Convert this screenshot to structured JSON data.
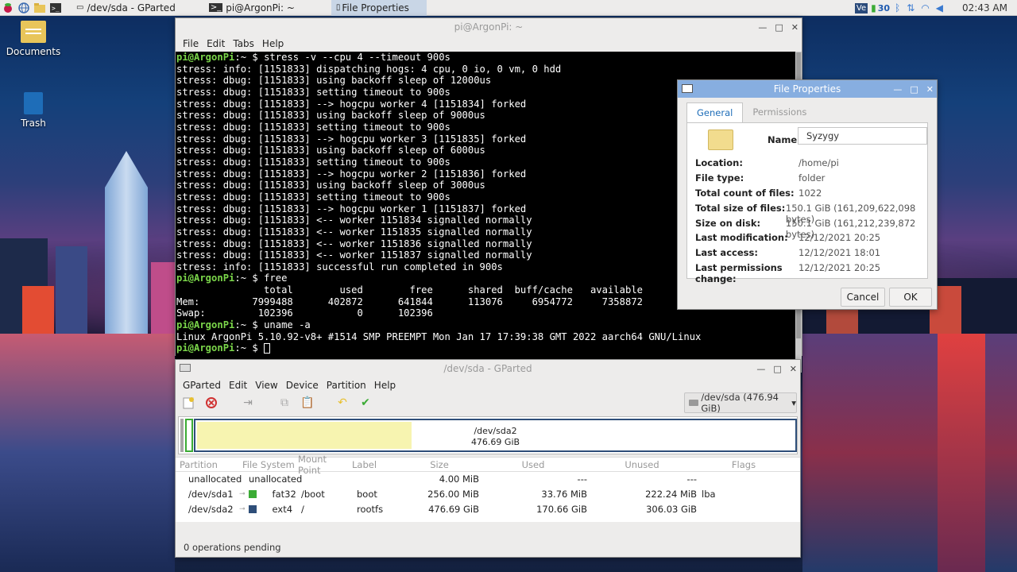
{
  "taskbar": {
    "tasks": [
      {
        "label": "/dev/sda - GParted",
        "icon": "gparted-icon"
      },
      {
        "label": "pi@ArgonPi: ~",
        "icon": "terminal-icon"
      },
      {
        "label": "File Properties",
        "icon": "file-icon"
      }
    ],
    "tray": {
      "cpu_temp": "30",
      "clock": "02:43 AM"
    }
  },
  "desktop": {
    "icons": [
      {
        "label": "Documents",
        "icon": "folder-icon"
      },
      {
        "label": "Trash",
        "icon": "trash-icon"
      }
    ]
  },
  "terminal": {
    "title": "pi@ArgonPi: ~",
    "menu": [
      "File",
      "Edit",
      "Tabs",
      "Help"
    ],
    "prompt": "pi@ArgonPi",
    "prompt_suffix": ":~ $",
    "lines": [
      {
        "prompt": true,
        "text": " stress -v --cpu 4 --timeout 900s"
      },
      {
        "text": "stress: info: [1151833] dispatching hogs: 4 cpu, 0 io, 0 vm, 0 hdd"
      },
      {
        "text": "stress: dbug: [1151833] using backoff sleep of 12000us"
      },
      {
        "text": "stress: dbug: [1151833] setting timeout to 900s"
      },
      {
        "text": "stress: dbug: [1151833] --> hogcpu worker 4 [1151834] forked"
      },
      {
        "text": "stress: dbug: [1151833] using backoff sleep of 9000us"
      },
      {
        "text": "stress: dbug: [1151833] setting timeout to 900s"
      },
      {
        "text": "stress: dbug: [1151833] --> hogcpu worker 3 [1151835] forked"
      },
      {
        "text": "stress: dbug: [1151833] using backoff sleep of 6000us"
      },
      {
        "text": "stress: dbug: [1151833] setting timeout to 900s"
      },
      {
        "text": "stress: dbug: [1151833] --> hogcpu worker 2 [1151836] forked"
      },
      {
        "text": "stress: dbug: [1151833] using backoff sleep of 3000us"
      },
      {
        "text": "stress: dbug: [1151833] setting timeout to 900s"
      },
      {
        "text": "stress: dbug: [1151833] --> hogcpu worker 1 [1151837] forked"
      },
      {
        "text": "stress: dbug: [1151833] <-- worker 1151834 signalled normally"
      },
      {
        "text": "stress: dbug: [1151833] <-- worker 1151835 signalled normally"
      },
      {
        "text": "stress: dbug: [1151833] <-- worker 1151836 signalled normally"
      },
      {
        "text": "stress: dbug: [1151833] <-- worker 1151837 signalled normally"
      },
      {
        "text": "stress: info: [1151833] successful run completed in 900s"
      },
      {
        "prompt": true,
        "text": " free"
      },
      {
        "text": "               total        used        free      shared  buff/cache   available"
      },
      {
        "text": "Mem:         7999488      402872      641844      113076     6954772     7358872"
      },
      {
        "text": "Swap:         102396           0      102396"
      },
      {
        "prompt": true,
        "text": " uname -a"
      },
      {
        "text": "Linux ArgonPi 5.10.92-v8+ #1514 SMP PREEMPT Mon Jan 17 17:39:38 GMT 2022 aarch64 GNU/Linux"
      },
      {
        "prompt": true,
        "text": " ",
        "cursor": true
      }
    ]
  },
  "file_properties": {
    "title": "File Properties",
    "tabs": [
      "General",
      "Permissions"
    ],
    "name_label": "Name:",
    "name_value": "Syzygy",
    "rows": [
      {
        "label": "Location:",
        "value": "/home/pi"
      },
      {
        "label": "File type:",
        "value": "folder"
      },
      {
        "label": "Total count of files:",
        "value": "1022"
      },
      {
        "label": "Total size of files:",
        "value": "150.1 GiB (161,209,622,098 bytes)"
      },
      {
        "label": "Size on disk:",
        "value": "150.1 GiB (161,212,239,872 bytes)"
      },
      {
        "label": "Last modification:",
        "value": "12/12/2021 20:25"
      },
      {
        "label": "Last access:",
        "value": "12/12/2021 18:01"
      },
      {
        "label": "Last permissions change:",
        "value": "12/12/2021 20:25"
      }
    ],
    "cancel_label": "Cancel",
    "ok_label": "OK"
  },
  "gparted": {
    "title": "/dev/sda - GParted",
    "menu": [
      "GParted",
      "Edit",
      "View",
      "Device",
      "Partition",
      "Help"
    ],
    "device_selector": "/dev/sda (476.94 GiB)",
    "diskmap": {
      "name": "/dev/sda2",
      "size": "476.69 GiB",
      "used_fraction": 0.36
    },
    "columns": [
      "Partition",
      "File System",
      "Mount Point",
      "Label",
      "Size",
      "Used",
      "Unused",
      "Flags"
    ],
    "rows": [
      {
        "partition": "unallocated",
        "fs": "unallocated",
        "mount": "",
        "label": "",
        "size": "4.00 MiB",
        "used": "---",
        "unused": "---",
        "flags": "",
        "color": "#a8a8a8",
        "key": false
      },
      {
        "partition": "/dev/sda1",
        "fs": "fat32",
        "mount": "/boot",
        "label": "boot",
        "size": "256.00 MiB",
        "used": "33.76 MiB",
        "unused": "222.24 MiB",
        "flags": "lba",
        "color": "#3bab35",
        "key": true
      },
      {
        "partition": "/dev/sda2",
        "fs": "ext4",
        "mount": "/",
        "label": "rootfs",
        "size": "476.69 GiB",
        "used": "170.66 GiB",
        "unused": "306.03 GiB",
        "flags": "",
        "color": "#2e4e79",
        "key": true
      }
    ],
    "status": "0 operations pending"
  }
}
